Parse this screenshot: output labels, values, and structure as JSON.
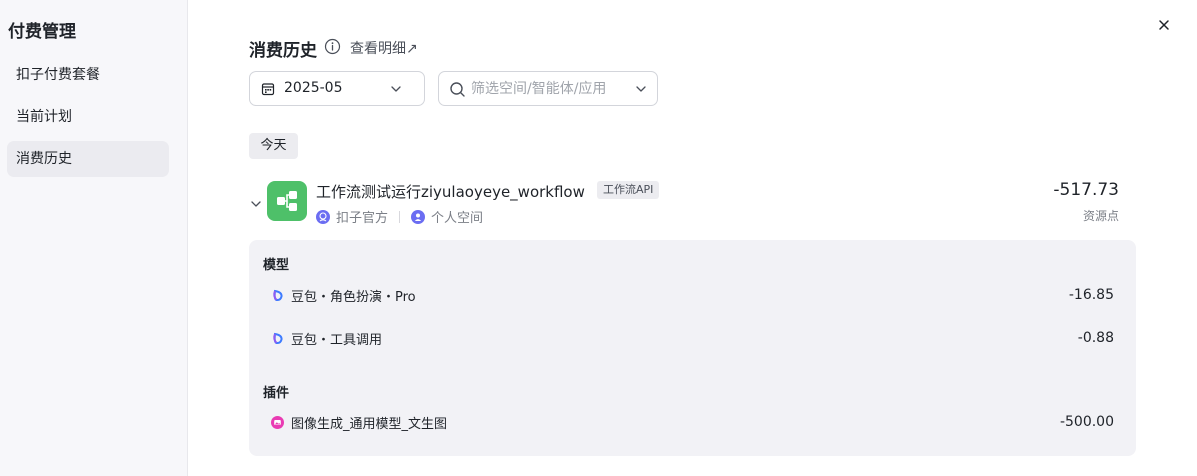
{
  "sidebar": {
    "title": "付费管理",
    "items": [
      {
        "label": "扣子付费套餐"
      },
      {
        "label": "当前计划"
      },
      {
        "label": "消费历史"
      }
    ]
  },
  "header": {
    "title": "消费历史",
    "detail_link": "查看明细↗"
  },
  "filters": {
    "date_value": "2025-05",
    "search_placeholder": "筛选空间/智能体/应用"
  },
  "day_label": "今天",
  "record": {
    "name": "工作流测试运行ziyulaoyeye_workflow",
    "tag": "工作流API",
    "owner": "扣子官方",
    "space": "个人空间",
    "amount": "-517.73",
    "unit": "资源点",
    "sections": [
      {
        "title": "模型",
        "items": [
          {
            "name": "豆包・角色扮演・Pro",
            "amount": "-16.85",
            "icon": "doubao-icon"
          },
          {
            "name": "豆包・工具调用",
            "amount": "-0.88",
            "icon": "doubao-icon"
          }
        ]
      },
      {
        "title": "插件",
        "items": [
          {
            "name": "图像生成_通用模型_文生图",
            "amount": "-500.00",
            "icon": "image-gen-icon"
          }
        ]
      }
    ]
  },
  "colors": {
    "workflow_icon_bg": "#4ec069",
    "avatar": "#6b6df2",
    "plugin_icon": "#e93bb3"
  }
}
